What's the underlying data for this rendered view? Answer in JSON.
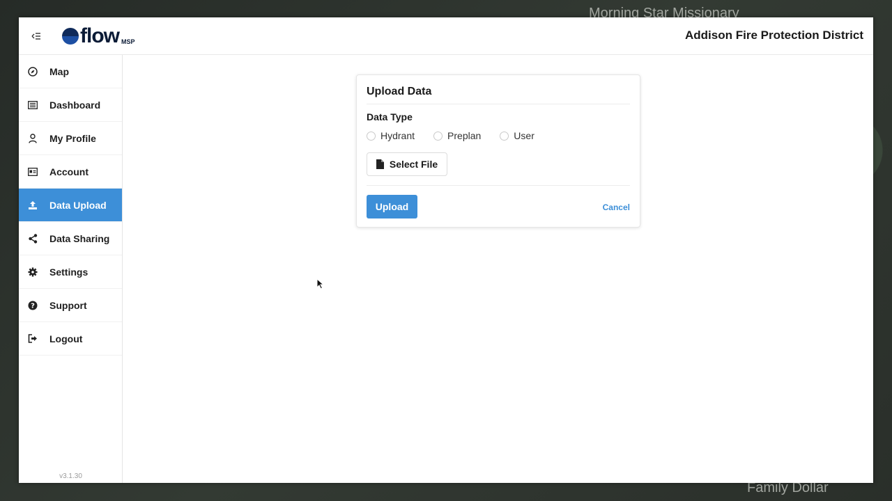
{
  "map": {
    "labels": [
      "Morning Star Missionary",
      "Family Dollar"
    ]
  },
  "header": {
    "logo_text": "flow",
    "logo_sub": "MSP",
    "org_name": "Addison Fire Protection District"
  },
  "sidebar": {
    "items": [
      {
        "label": "Map",
        "icon": "compass-icon"
      },
      {
        "label": "Dashboard",
        "icon": "list-icon"
      },
      {
        "label": "My Profile",
        "icon": "user-icon"
      },
      {
        "label": "Account",
        "icon": "id-card-icon"
      },
      {
        "label": "Data Upload",
        "icon": "upload-icon",
        "active": true
      },
      {
        "label": "Data Sharing",
        "icon": "share-icon"
      },
      {
        "label": "Settings",
        "icon": "gear-icon"
      },
      {
        "label": "Support",
        "icon": "question-icon"
      },
      {
        "label": "Logout",
        "icon": "logout-icon"
      }
    ],
    "version": "v3.1.30"
  },
  "upload_card": {
    "title": "Upload Data",
    "data_type_label": "Data Type",
    "options": [
      "Hydrant",
      "Preplan",
      "User"
    ],
    "select_file_label": "Select File",
    "upload_label": "Upload",
    "cancel_label": "Cancel"
  },
  "colors": {
    "accent": "#3d8fd8",
    "text": "#1a1a1a"
  }
}
